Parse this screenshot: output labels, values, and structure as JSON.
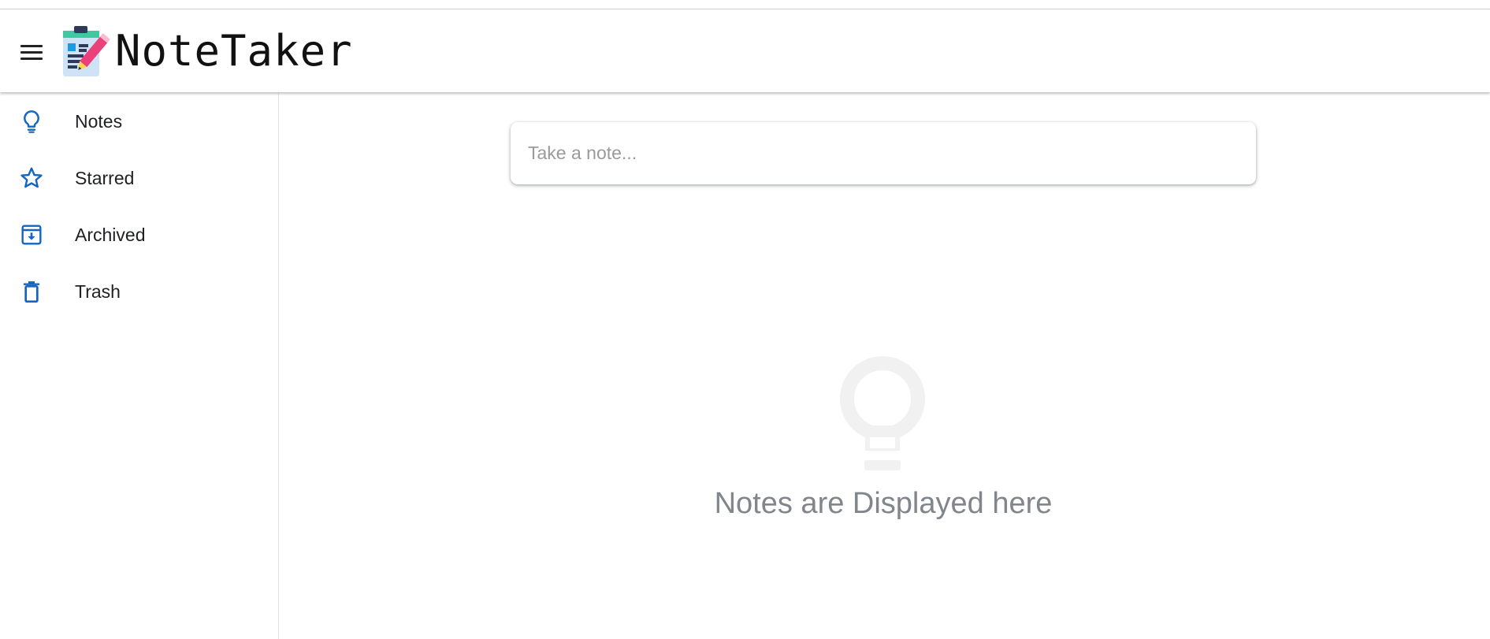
{
  "header": {
    "app_title": "NoteTaker",
    "menu_icon": "hamburger-menu-icon",
    "logo_icon": "notepad-pencil-logo"
  },
  "sidebar": {
    "items": [
      {
        "label": "Notes",
        "icon": "lightbulb-icon",
        "active": true
      },
      {
        "label": "Starred",
        "icon": "star-icon"
      },
      {
        "label": "Archived",
        "icon": "archive-icon"
      },
      {
        "label": "Trash",
        "icon": "trash-icon"
      }
    ]
  },
  "main": {
    "note_input": {
      "placeholder": "Take a note...",
      "value": ""
    },
    "empty_state": {
      "icon": "lightbulb-icon",
      "message": "Notes are Displayed here"
    }
  },
  "colors": {
    "accent": "#1a73e8",
    "icon_blue": "#1565c0",
    "empty_icon": "#f1f1f1",
    "empty_text": "#80868b"
  }
}
